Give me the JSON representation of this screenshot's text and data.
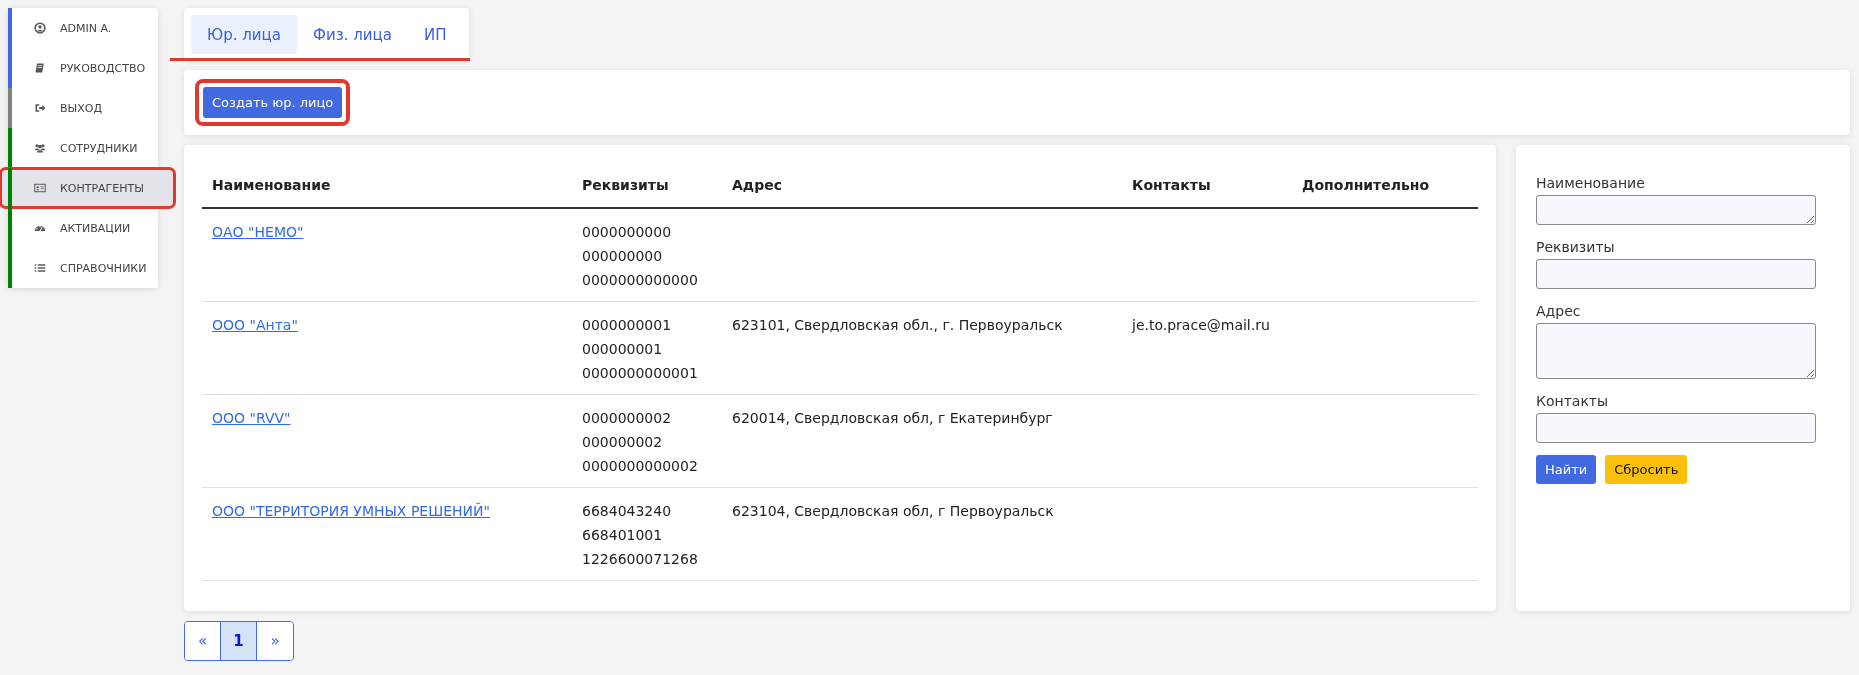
{
  "sidebar": {
    "items": [
      {
        "label": "ADMIN A.",
        "kind": "user",
        "color": "#4169e1",
        "selected": false,
        "highlighted": false
      },
      {
        "label": "РУКОВОДСТВО",
        "kind": "book",
        "color": "#4169e1",
        "selected": false,
        "highlighted": false
      },
      {
        "label": "ВЫХОД",
        "kind": "exit",
        "color": "#808080",
        "selected": false,
        "highlighted": false
      },
      {
        "label": "СОТРУДНИКИ",
        "kind": "users",
        "color": "#008000",
        "selected": false,
        "highlighted": false
      },
      {
        "label": "КОНТРАГЕНТЫ",
        "kind": "card",
        "color": "#008000",
        "selected": true,
        "highlighted": true
      },
      {
        "label": "АКТИВАЦИИ",
        "kind": "gauge",
        "color": "#008000",
        "selected": false,
        "highlighted": false
      },
      {
        "label": "СПРАВОЧНИКИ",
        "kind": "list",
        "color": "#008000",
        "selected": false,
        "highlighted": false
      }
    ]
  },
  "tabs": {
    "underlined": true,
    "items": [
      {
        "label": "Юр. лица",
        "selected": true
      },
      {
        "label": "Физ. лица",
        "selected": false
      },
      {
        "label": "ИП",
        "selected": false
      }
    ]
  },
  "create_button": {
    "label": "Создать юр. лицо",
    "highlighted": true
  },
  "table": {
    "columns": [
      "Наименование",
      "Реквизиты",
      "Адрес",
      "Контакты",
      "Дополнительно"
    ],
    "rows": [
      {
        "name": "ОАО \"НЕМО\"",
        "details": [
          "0000000000",
          "000000000",
          "0000000000000"
        ],
        "address": "",
        "contacts": ""
      },
      {
        "name": "ООО \"Анта\"",
        "details": [
          "0000000001",
          "000000001",
          "0000000000001"
        ],
        "address": "623101, Свердловская обл., г. Первоуральск",
        "contacts": "je.to.prace@mail.ru"
      },
      {
        "name": "ООО \"RVV\"",
        "details": [
          "0000000002",
          "000000002",
          "0000000000002"
        ],
        "address": "620014, Свердловская обл, г Екатеринбург",
        "contacts": ""
      },
      {
        "name": "ООО \"ТЕРРИТОРИЯ УМНЫХ РЕШЕНИЙ\"",
        "details": [
          "6684043240",
          "668401001",
          "1226600071268"
        ],
        "address": "623104, Свердловская обл, г Первоуральск",
        "contacts": ""
      }
    ]
  },
  "pagination": [
    {
      "label": "«",
      "selected": false
    },
    {
      "label": "1",
      "selected": true
    },
    {
      "label": "»",
      "selected": false
    }
  ],
  "filter": {
    "fields": [
      {
        "label": "Наименование",
        "kind": "textarea"
      },
      {
        "label": "Реквизиты",
        "kind": "input"
      },
      {
        "label": "Адрес",
        "kind": "textarea"
      },
      {
        "label": "Контакты",
        "kind": "input"
      }
    ],
    "buttons": [
      {
        "label": "Найти",
        "kind": "primary"
      },
      {
        "label": "Сбросить",
        "kind": "warning"
      }
    ]
  }
}
